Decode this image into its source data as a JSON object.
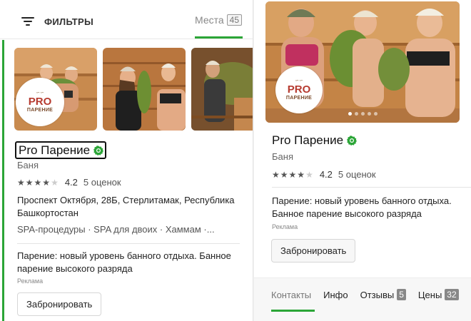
{
  "header": {
    "filter_label": "ФИЛЬТРЫ",
    "places_label": "Места",
    "places_count": "45"
  },
  "left_card": {
    "title": "Pro Парение",
    "category": "Баня",
    "rating": "4.2",
    "rating_stars": 4.2,
    "reviews": "5 оценок",
    "address": "Проспект Октября, 28Б, Стерлитамак, Республика Башкортостан",
    "features": "SPA-процедуры · SPA для двоих · Хаммам ·...",
    "ad_text": "Парение: новый уровень банного отдыха. Банное парение высокого разряда",
    "ad_label": "Реклама",
    "book_label": "Забронировать"
  },
  "logo": {
    "pro": "PRO",
    "name": "ПАРЕНИЕ"
  },
  "right_card": {
    "title": "Pro Парение",
    "category": "Баня",
    "rating": "4.2",
    "reviews": "5 оценок",
    "ad_text": "Парение: новый уровень банного отдыха. Банное парение высокого разряда",
    "ad_label": "Реклама",
    "book_label": "Забронировать",
    "photo_dots_total": 5,
    "photo_dots_active": 1
  },
  "tabs": [
    {
      "label": "Контакты",
      "badge": ""
    },
    {
      "label": "Инфо",
      "badge": ""
    },
    {
      "label": "Отзывы",
      "badge": "5"
    },
    {
      "label": "Цены",
      "badge": "32"
    }
  ],
  "colors": {
    "accent": "#2ba537",
    "wood": "#c58a52",
    "text": "#222222"
  }
}
